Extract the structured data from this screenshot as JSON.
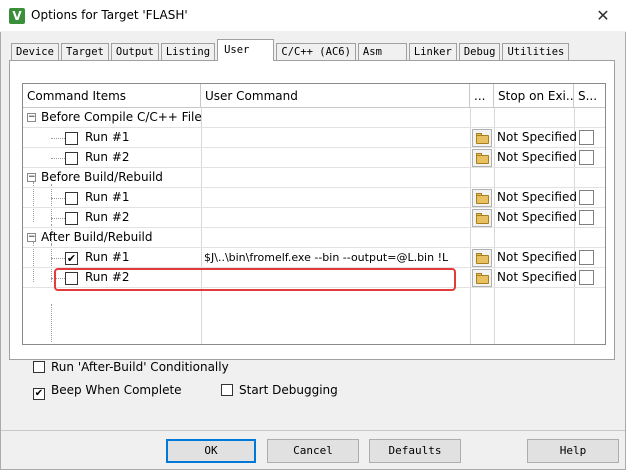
{
  "window": {
    "title": "Options for Target 'FLASH'",
    "app_icon_glyph": "V",
    "close_glyph": "✕"
  },
  "tabs": [
    {
      "label": "Device"
    },
    {
      "label": "Target"
    },
    {
      "label": "Output"
    },
    {
      "label": "Listing"
    },
    {
      "label": "User",
      "active": true
    },
    {
      "label": "C/C++ (AC6)"
    },
    {
      "label": "Asm"
    },
    {
      "label": "Linker"
    },
    {
      "label": "Debug"
    },
    {
      "label": "Utilities"
    }
  ],
  "grid": {
    "headers": {
      "items": "Command Items",
      "command": "User Command",
      "browse": "...",
      "stop": "Stop on Exi...",
      "s": "S..."
    },
    "groups": {
      "before_compile": "Before Compile C/C++ File",
      "before_build": "Before Build/Rebuild",
      "after_build": "After Build/Rebuild"
    },
    "runs": {
      "run1": "Run #1",
      "run2": "Run #2"
    },
    "not_specified": "Not Specified",
    "after_build_run1_command": "$J\\..\\bin\\fromelf.exe --bin --output=@L.bin !L",
    "collapse_glyph": "−",
    "check_glyph": "✔"
  },
  "options": {
    "run_after_build": {
      "label": "Run 'After-Build' Conditionally",
      "checked": false
    },
    "beep": {
      "label": "Beep When Complete",
      "checked": true
    },
    "start_debugging": {
      "label": "Start Debugging",
      "checked": false
    }
  },
  "buttons": {
    "ok": "OK",
    "cancel": "Cancel",
    "defaults": "Defaults",
    "help": "Help"
  },
  "colors": {
    "highlight_border": "#e23b3b",
    "default_button_border": "#0078d7"
  }
}
